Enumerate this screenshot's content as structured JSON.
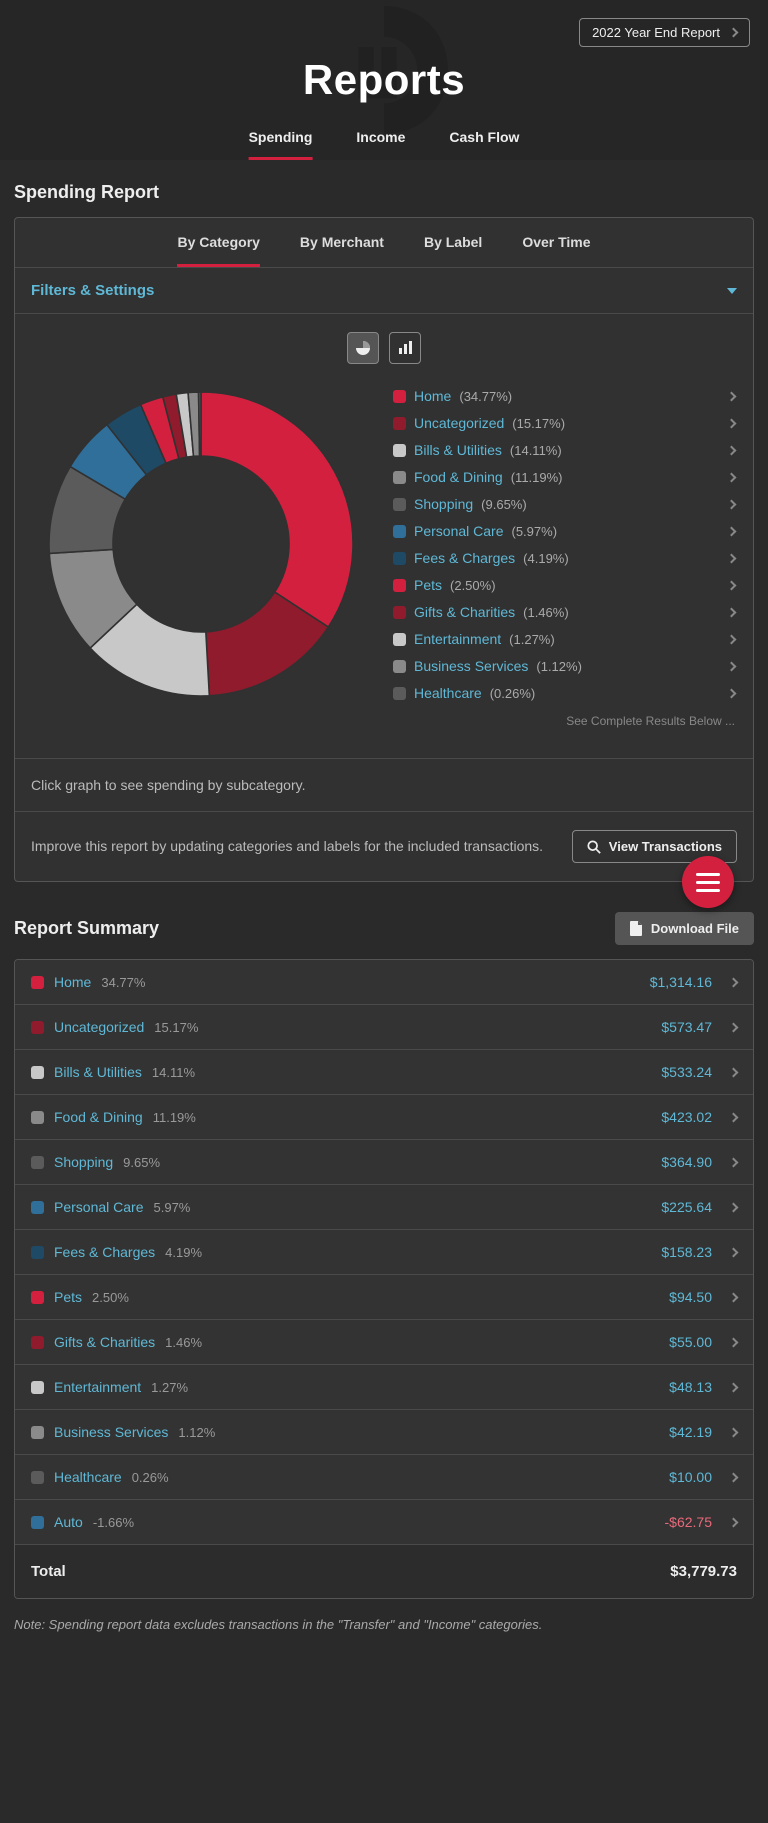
{
  "hero": {
    "year_button": "2022 Year End Report",
    "title": "Reports",
    "tabs": [
      "Spending",
      "Income",
      "Cash Flow"
    ],
    "active_tab": 0
  },
  "spending": {
    "title": "Spending Report",
    "sub_tabs": [
      "By Category",
      "By Merchant",
      "By Label",
      "Over Time"
    ],
    "active_sub_tab": 0,
    "filters_label": "Filters & Settings",
    "legend_more": "See Complete Results Below ...",
    "hint": "Click graph to see spending by subcategory.",
    "improve_text": "Improve this report by updating categories and labels for the included transactions.",
    "view_transactions_label": "View Transactions"
  },
  "summary": {
    "title": "Report Summary",
    "download_label": "Download File",
    "total_label": "Total",
    "total_amount": "$3,779.73",
    "footnote": "Note: Spending report data excludes transactions in the \"Transfer\" and \"Income\" categories.",
    "rows": [
      {
        "name": "Home",
        "pct": "34.77%",
        "amount": "$1,314.16",
        "neg": false,
        "color": "#d4203f"
      },
      {
        "name": "Uncategorized",
        "pct": "15.17%",
        "amount": "$573.47",
        "neg": false,
        "color": "#8f1b2d"
      },
      {
        "name": "Bills & Utilities",
        "pct": "14.11%",
        "amount": "$533.24",
        "neg": false,
        "color": "#c8c8c8"
      },
      {
        "name": "Food & Dining",
        "pct": "11.19%",
        "amount": "$423.02",
        "neg": false,
        "color": "#8a8a8a"
      },
      {
        "name": "Shopping",
        "pct": "9.65%",
        "amount": "$364.90",
        "neg": false,
        "color": "#5b5b5b"
      },
      {
        "name": "Personal Care",
        "pct": "5.97%",
        "amount": "$225.64",
        "neg": false,
        "color": "#2f6f9a"
      },
      {
        "name": "Fees & Charges",
        "pct": "4.19%",
        "amount": "$158.23",
        "neg": false,
        "color": "#1e4a66"
      },
      {
        "name": "Pets",
        "pct": "2.50%",
        "amount": "$94.50",
        "neg": false,
        "color": "#d4203f"
      },
      {
        "name": "Gifts & Charities",
        "pct": "1.46%",
        "amount": "$55.00",
        "neg": false,
        "color": "#8f1b2d"
      },
      {
        "name": "Entertainment",
        "pct": "1.27%",
        "amount": "$48.13",
        "neg": false,
        "color": "#c8c8c8"
      },
      {
        "name": "Business Services",
        "pct": "1.12%",
        "amount": "$42.19",
        "neg": false,
        "color": "#8a8a8a"
      },
      {
        "name": "Healthcare",
        "pct": "0.26%",
        "amount": "$10.00",
        "neg": false,
        "color": "#5b5b5b"
      },
      {
        "name": "Auto",
        "pct": "-1.66%",
        "amount": "-$62.75",
        "neg": true,
        "color": "#2f6f9a"
      }
    ]
  },
  "chart_data": {
    "type": "pie",
    "title": "Spending by Category",
    "series": [
      {
        "name": "Home",
        "value": 34.77,
        "color": "#d4203f"
      },
      {
        "name": "Uncategorized",
        "value": 15.17,
        "color": "#8f1b2d"
      },
      {
        "name": "Bills & Utilities",
        "value": 14.11,
        "color": "#c8c8c8"
      },
      {
        "name": "Food & Dining",
        "value": 11.19,
        "color": "#8a8a8a"
      },
      {
        "name": "Shopping",
        "value": 9.65,
        "color": "#5b5b5b"
      },
      {
        "name": "Personal Care",
        "value": 5.97,
        "color": "#2f6f9a"
      },
      {
        "name": "Fees & Charges",
        "value": 4.19,
        "color": "#1e4a66"
      },
      {
        "name": "Pets",
        "value": 2.5,
        "color": "#d4203f"
      },
      {
        "name": "Gifts & Charities",
        "value": 1.46,
        "color": "#8f1b2d"
      },
      {
        "name": "Entertainment",
        "value": 1.27,
        "color": "#c8c8c8"
      },
      {
        "name": "Business Services",
        "value": 1.12,
        "color": "#8a8a8a"
      },
      {
        "name": "Healthcare",
        "value": 0.26,
        "color": "#5b5b5b"
      }
    ],
    "legend_note": "See Complete Results Below ..."
  }
}
